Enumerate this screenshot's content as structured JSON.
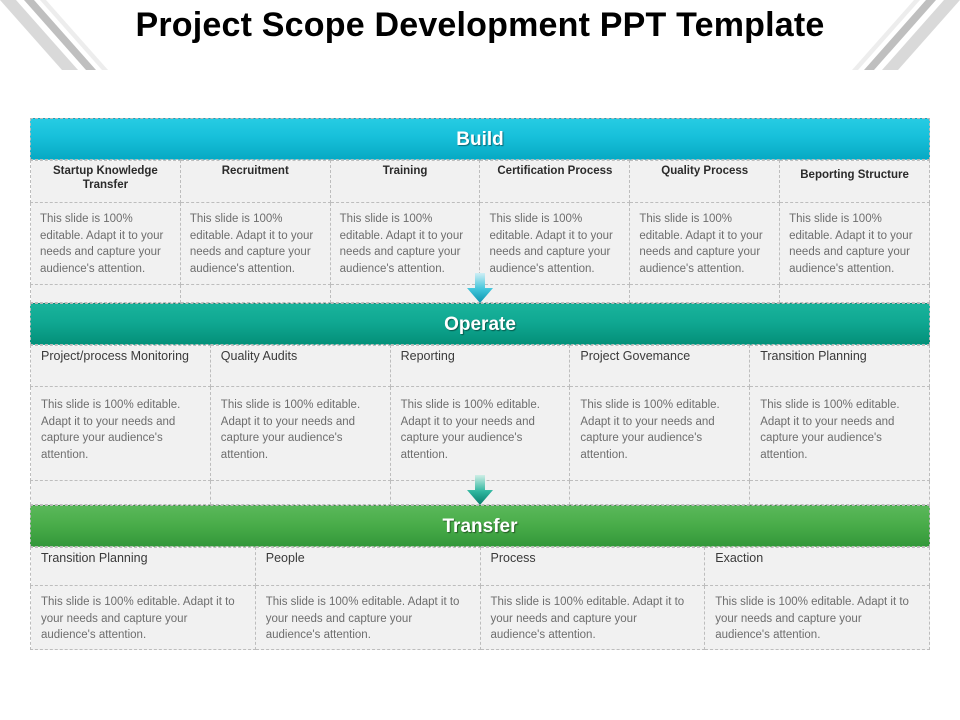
{
  "page_title": "Project Scope Development PPT Template",
  "body_text_variant_a": "This slide is 100% editable. Adapt it to your needs and capture your audience's attention.",
  "colors": {
    "build_accent": "#17C0DA",
    "operate_accent": "#10A892",
    "transfer_accent": "#4AAD4A",
    "cell_background": "#F1F1F1",
    "cell_border": "#BDBDBD",
    "body_text": "#6D6D6D",
    "header_text": "#2B2B2B",
    "title_text": "#000000"
  },
  "sections": [
    {
      "id": "build",
      "banner_label": "Build",
      "column_count": 6,
      "columns": [
        {
          "header": "Startup Knowledge Transfer",
          "body": "This slide is 100% editable. Adapt it to your needs and capture your audience's attention."
        },
        {
          "header": "Recruitment",
          "body": "This slide is 100% editable. Adapt it to your needs and capture your audience's attention."
        },
        {
          "header": "Training",
          "body": "This slide is 100% editable. Adapt it to your needs and capture your audience's attention."
        },
        {
          "header": "Certification Process",
          "body": "This slide is 100% editable. Adapt it to your needs and capture your audience's attention."
        },
        {
          "header": "Quality Process",
          "body": "This slide is 100% editable. Adapt it to your needs and capture your audience's attention."
        },
        {
          "header": "Beporting Structure",
          "body": "This slide is 100% editable. Adapt it to your needs and capture your audience's attention."
        }
      ]
    },
    {
      "id": "operate",
      "banner_label": "Operate",
      "column_count": 5,
      "columns": [
        {
          "header": "Project/process Monitoring",
          "body": "This slide is 100% editable. Adapt it to your needs and capture your audience's attention."
        },
        {
          "header": "Quality Audits",
          "body": "This slide is 100% editable. Adapt it to your needs and capture your audience's attention."
        },
        {
          "header": "Reporting",
          "body": "This slide is 100% editable. Adapt it to your needs and capture your audience's attention."
        },
        {
          "header": "Project Govemance",
          "body": "This slide is 100% editable. Adapt it to your needs and capture your audience's attention."
        },
        {
          "header": "Transition Planning",
          "body": "This slide is 100% editable. Adapt it to your needs and capture your audience's attention."
        }
      ]
    },
    {
      "id": "transfer",
      "banner_label": "Transfer",
      "column_count": 4,
      "columns": [
        {
          "header": "Transition Planning",
          "body": "This slide is 100% editable. Adapt it to your needs and capture your audience's attention."
        },
        {
          "header": "People",
          "body": "This slide is 100% editable. Adapt it to your needs and capture your audience's attention."
        },
        {
          "header": "Process",
          "body": "This slide is 100% editable. Adapt it to your needs and capture your audience's attention."
        },
        {
          "header": "Exaction",
          "body": "This slide is 100% editable. Adapt it to your needs and capture your audience's attention."
        }
      ]
    }
  ],
  "connectors": [
    {
      "id": "build-to-operate",
      "icon": "down-arrow-icon",
      "color": "#1DBBD4"
    },
    {
      "id": "operate-to-transfer",
      "icon": "down-arrow-icon",
      "color": "#139E88"
    }
  ],
  "decorations": [
    {
      "id": "corner-slash-left",
      "icon": "diagonal-slash-icon"
    },
    {
      "id": "corner-slash-right",
      "icon": "diagonal-slash-icon"
    }
  ]
}
